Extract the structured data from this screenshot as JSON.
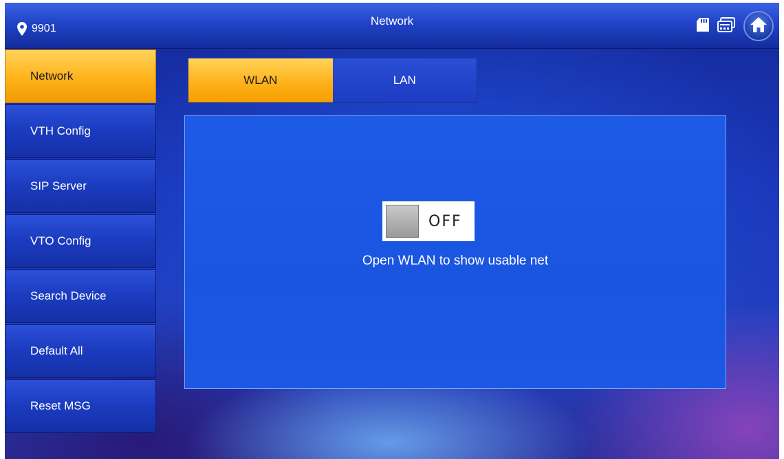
{
  "header": {
    "location_icon": "location-pin-icon",
    "location_text": "9901",
    "title": "Network",
    "icons": [
      "sd-card-icon",
      "message-icon",
      "home-icon"
    ]
  },
  "sidebar": {
    "items": [
      {
        "label": "Network",
        "active": true
      },
      {
        "label": "VTH Config",
        "active": false
      },
      {
        "label": "SIP Server",
        "active": false
      },
      {
        "label": "VTO Config",
        "active": false
      },
      {
        "label": "Search Device",
        "active": false
      },
      {
        "label": "Default All",
        "active": false
      },
      {
        "label": "Reset MSG",
        "active": false
      }
    ]
  },
  "tabs": [
    {
      "label": "WLAN",
      "active": true
    },
    {
      "label": "LAN",
      "active": false
    }
  ],
  "wlan": {
    "toggle_state": "OFF",
    "hint": "Open WLAN to show usable net"
  },
  "colors": {
    "accent": "#ffb21a",
    "background": "#1a36b8",
    "panel": "#1d5ae6"
  }
}
